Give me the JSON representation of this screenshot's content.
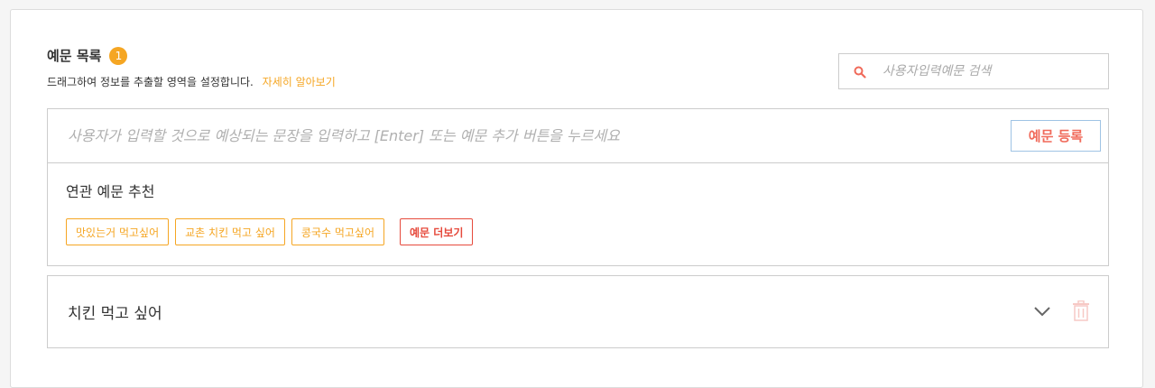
{
  "section": {
    "title": "예문 목록",
    "count": "1",
    "subtitle": "드래그하여 정보를 추출할 영역을 설정합니다.",
    "learn_more": "자세히 알아보기"
  },
  "search": {
    "placeholder": "사용자입력예문 검색",
    "value": "",
    "icon": "search-icon"
  },
  "editor": {
    "placeholder": "사용자가 입력할 것으로 예상되는 문장을 입력하고 [Enter] 또는 예문 추가 버튼을 누르세요",
    "value": "",
    "register_label": "예문 등록"
  },
  "recommendations": {
    "title": "연관 예문 추천",
    "chips": [
      "맛있는거 먹고싶어",
      "교촌 치킨 먹고 싶어",
      "콩국수 먹고싶어"
    ],
    "more_label": "예문 더보기"
  },
  "items": [
    {
      "text": "치킨 먹고 싶어",
      "icons": [
        "chevron-down-icon",
        "trash-icon"
      ]
    }
  ],
  "colors": {
    "accent_orange": "#f5a623",
    "accent_red": "#e64a3c",
    "border": "#cccccc"
  }
}
